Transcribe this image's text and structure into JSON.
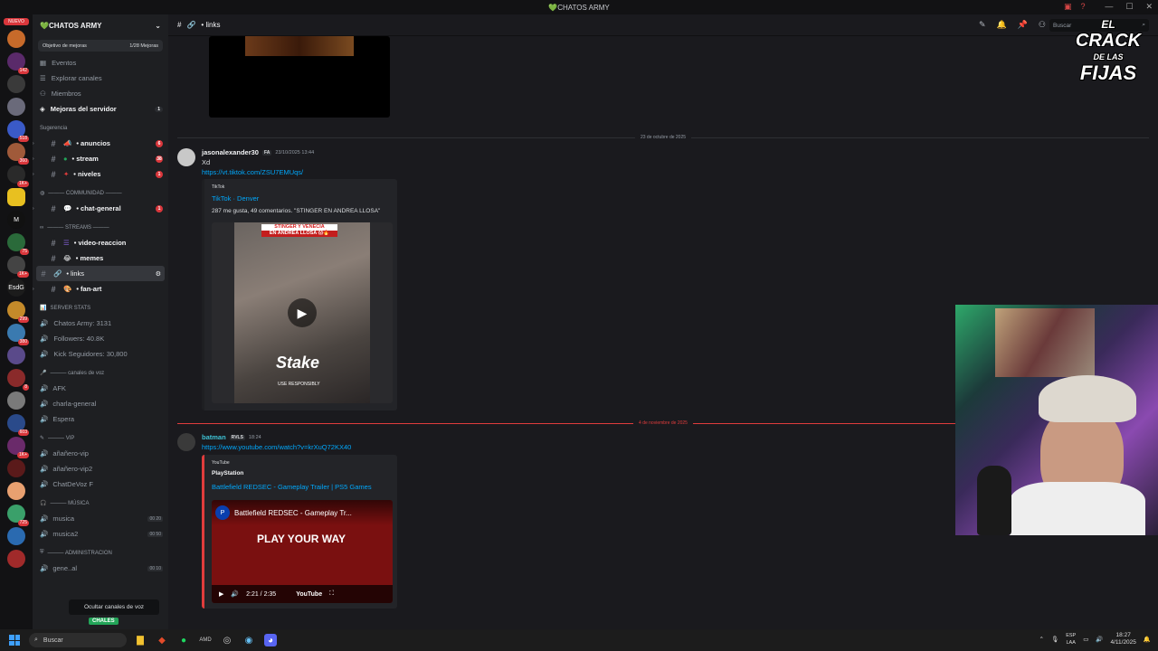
{
  "window": {
    "title": "💚CHATOS ARMY"
  },
  "server": {
    "name": "💚CHATOS ARMY",
    "boost_label": "Objetivo de mejoras",
    "boost_count": "1/28 Mejoras"
  },
  "nav": [
    {
      "label": "Eventos"
    },
    {
      "label": "Explorar canales"
    },
    {
      "label": "Miembros"
    },
    {
      "label": "Mejoras del servidor",
      "badge": "1"
    }
  ],
  "categories": {
    "suggestion": "Sugerencia",
    "community": "——— COMMUNIDAD ———",
    "streams": "——— STREAMS ———",
    "stats": "SERVER STATS",
    "voice": "——— canales de voz",
    "vip": "——— VIP",
    "music": "——— MÚSICA",
    "admin": "——— ADMINISTRACION"
  },
  "channels": {
    "suggestion": [
      {
        "name": "• anuncios",
        "badge": "6"
      },
      {
        "name": "• stream",
        "badge": "38"
      },
      {
        "name": "• niveles",
        "badge": "1"
      }
    ],
    "community": [
      {
        "name": "• chat-general",
        "badge": "1"
      }
    ],
    "streams": [
      {
        "name": "• video-reaccion"
      },
      {
        "name": "• memes"
      },
      {
        "name": "• links"
      },
      {
        "name": "• fan-art"
      }
    ]
  },
  "stats": [
    "Chatos Army: 3131",
    "Followers: 40.8K",
    "Kick Seguidores: 30,800"
  ],
  "voice": [
    "AFK",
    "charla-general",
    "Espera"
  ],
  "vip": [
    "añañero-vip",
    "añañero-vip2",
    "ChatDeVoz F"
  ],
  "music": [
    {
      "name": "musica",
      "count": "00 20"
    },
    {
      "name": "musica2",
      "count": "00 50"
    }
  ],
  "admin": [
    {
      "name": "gene..al",
      "count": "00 10"
    }
  ],
  "tooltip": {
    "hide_voice": "Ocultar canales de voz",
    "user_tag": "CHALES"
  },
  "header": {
    "channel": "• links",
    "search_placeholder": "Buscar"
  },
  "messages": {
    "date1": "23 de octubre de 2025",
    "date2": "4 de noviembre de 2025",
    "m1": {
      "author": "jasonalexander30",
      "tag": "FA",
      "time": "23/10/2025 13:44",
      "text": "Xd",
      "link": "https://vt.tiktok.com/ZSU7EMUqs/",
      "embed": {
        "provider": "TikTok",
        "title": "TikTok · Denver",
        "desc": "287 me gusta, 49 comentarios. \"STINGER EN ANDREA LLOSA\"",
        "cap1": "STINGER Y VENECIA",
        "cap2": "EN ANDREA LLOSA 😱🔥",
        "brand": "Stake",
        "responsibly": "USE RESPONSIBLY"
      }
    },
    "m2": {
      "author": "batman",
      "tag": "RVLS",
      "time": "18:24",
      "link": "https://www.youtube.com/watch?v=krXuQ72KX40",
      "embed": {
        "provider": "YouTube",
        "channel": "PlayStation",
        "title": "Battlefield REDSEC - Gameplay Trailer | PS5 Games",
        "video_title": "Battlefield REDSEC - Gameplay Tr...",
        "overlay": "PLAY YOUR WAY",
        "time": "2:21 / 2:35",
        "brand": "YouTube"
      }
    }
  },
  "overlay_logo": {
    "l1": "EL",
    "l2": "CRACK",
    "l3": "DE LAS",
    "l4": "FIJAS"
  },
  "taskbar": {
    "search": "Buscar",
    "lang1": "ESP",
    "lang2": "LAA",
    "time": "18:27",
    "date": "4/11/2025"
  },
  "guild_badges": [
    "142",
    "518",
    "360",
    "1K+",
    "75",
    "1K+",
    "299",
    "380",
    "8",
    "603",
    "1K+",
    "725"
  ]
}
